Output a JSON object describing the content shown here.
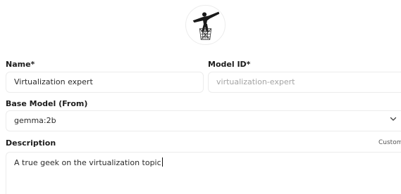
{
  "avatar": {
    "icon": "ninja-fighter-logo-icon"
  },
  "form": {
    "name": {
      "label": "Name*",
      "value": "Virtualization expert"
    },
    "model_id": {
      "label": "Model ID*",
      "placeholder": "virtualization-expert"
    },
    "base_model": {
      "label": "Base Model (From)",
      "selected": "gemma:2b"
    },
    "description": {
      "label": "Description",
      "custom_link": "Custom",
      "value": "A true geek on the virtualization topic"
    }
  }
}
